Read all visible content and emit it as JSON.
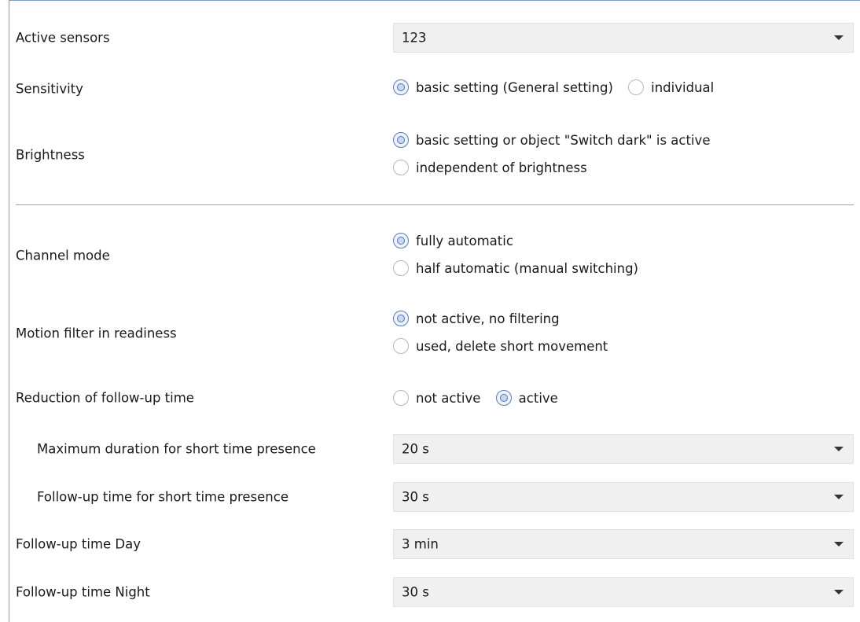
{
  "rows": {
    "active_sensors": {
      "label": "Active sensors",
      "value": "123"
    },
    "sensitivity": {
      "label": "Sensitivity",
      "options": [
        "basic setting (General setting)",
        "individual"
      ],
      "selected": 0
    },
    "brightness": {
      "label": "Brightness",
      "options": [
        "basic setting or object \"Switch dark\" is active",
        "independent of brightness"
      ],
      "selected": 0
    },
    "channel_mode": {
      "label": "Channel mode",
      "options": [
        "fully automatic",
        "half automatic (manual switching)"
      ],
      "selected": 0
    },
    "motion_filter": {
      "label": "Motion filter in readiness",
      "options": [
        "not active, no filtering",
        "used, delete short movement"
      ],
      "selected": 0
    },
    "reduction": {
      "label": "Reduction of follow-up time",
      "options": [
        "not active",
        "active"
      ],
      "selected": 1
    },
    "max_duration": {
      "label": "Maximum duration for short time presence",
      "value": "20 s"
    },
    "followup_short": {
      "label": "Follow-up time for short time presence",
      "value": "30 s"
    },
    "followup_day": {
      "label": "Follow-up time Day",
      "value": "3 min"
    },
    "followup_night": {
      "label": "Follow-up time Night",
      "value": "30 s"
    }
  },
  "colors": {
    "frame": "#7a9cc6",
    "dropdown_bg": "#f0f0f0",
    "radio_selected": "#4f77b3"
  }
}
